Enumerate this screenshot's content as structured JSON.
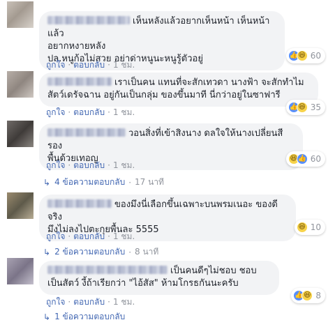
{
  "icons": {
    "like": "like-icon",
    "haha": "haha-icon",
    "reply_arrow": "reply-arrow-icon"
  },
  "colors": {
    "link": "#4267b2",
    "bubble": "#f2f3f5",
    "like": "#5890ff",
    "haha": "#f7d34a",
    "muted": "#90949c"
  },
  "labels": {
    "like": "ถูกใจ",
    "reply": "ตอบกลับ",
    "sep": "·"
  },
  "comments": [
    {
      "text_lines": [
        "เห็นหลังแล้วอยากเห็นหน้า เห็นหน้าแล้ว",
        "อยากหงายหลัง",
        "ปล.หนูก้อไม่สวย อย่าด่าหนูนะหนูรู้ตัวอยู่"
      ],
      "reactions": {
        "count": "60",
        "icons": [
          "like",
          "haha"
        ]
      },
      "time": "1 ชม.",
      "replies": null
    },
    {
      "text_lines": [
        "เราเป็นคน แทนที่จะสักเทวดา นางฟ้า จะสักทำไม",
        "สัตว์เดรัจฉาน อยู่กันเป็นกลุ่ม ของขึ้นมาที นี่กว่าอยู่ในซาฟารี"
      ],
      "reactions": {
        "count": "35",
        "icons": [
          "like",
          "haha"
        ]
      },
      "time": "1 ชม.",
      "replies": null
    },
    {
      "text_lines": [
        "วอนสิ่งที่เข้าสิงนาง ดลใจให้นางเปลี่ยนสีรอง",
        "พื้นด้วยเทอญ"
      ],
      "reactions": {
        "count": "60",
        "icons": [
          "haha",
          "like"
        ]
      },
      "time": "1 ชม.",
      "replies": {
        "label": "4 ข้อความตอบกลับ",
        "time": "17 นาที"
      }
    },
    {
      "text_lines": [
        "ของมึงนี่เลือกขึ้นเฉพาะบนพรมเนอะ ของดีจริง",
        "มึงไม่ลงไปตะกุยพื้นละ 5555"
      ],
      "reactions": {
        "count": "10",
        "icons": [
          "haha"
        ]
      },
      "time": "1 ชม.",
      "replies": {
        "label": "2 ข้อความตอบกลับ",
        "time": "8 นาที"
      }
    },
    {
      "text_lines": [
        "เป็นคนดีๆไม่ชอบ ชอบ",
        "เป็นสัตว์ งี้ถ้าเรียกว่า \"ไอ้สัส\" ห้ามโกรธกันนะครับ"
      ],
      "reactions": {
        "count": "8",
        "icons": [
          "like",
          "haha"
        ]
      },
      "time": "1 ชม.",
      "replies": {
        "label": "1 ข้อความตอบกลับ",
        "time": ""
      }
    }
  ]
}
